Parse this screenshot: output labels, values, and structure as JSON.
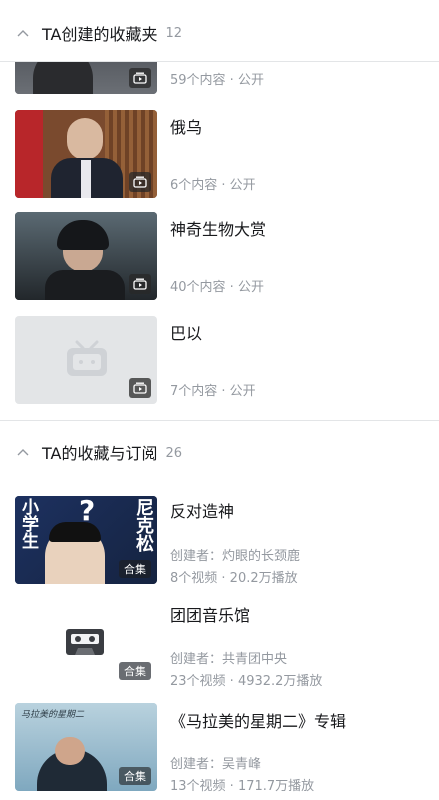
{
  "created": {
    "title": "TA创建的收藏夹",
    "count": "12",
    "items": [
      {
        "name": "",
        "meta": "59个内容 · 公开"
      },
      {
        "name": "俄乌",
        "meta": "6个内容 · 公开"
      },
      {
        "name": "神奇生物大赏",
        "meta": "40个内容 · 公开"
      },
      {
        "name": "巴以",
        "meta": "7个内容 · 公开"
      }
    ]
  },
  "subscribed": {
    "title": "TA的收藏与订阅",
    "count": "26",
    "items": [
      {
        "name": "反对造神",
        "creator": "创建者：灼眼的长颈鹿",
        "stats": "8个视频 · 20.2万播放",
        "badge": "合集",
        "thumb_text_left": "小学生",
        "thumb_text_right": "尼克松"
      },
      {
        "name": "团团音乐馆",
        "creator": "创建者：共青团中央",
        "stats": "23个视频 · 4932.2万播放",
        "badge": "合集"
      },
      {
        "name": "《马拉美的星期二》专辑",
        "creator": "创建者：吴青峰",
        "stats": "13个视频 · 171.7万播放",
        "badge": "合集",
        "thumb_text": "马拉美的星期二"
      }
    ]
  },
  "icons": {
    "collapse": "chevron-up-icon",
    "play_list": "playlist-play-icon",
    "placeholder": "tv-placeholder-icon",
    "cassette": "cassette-icon"
  }
}
